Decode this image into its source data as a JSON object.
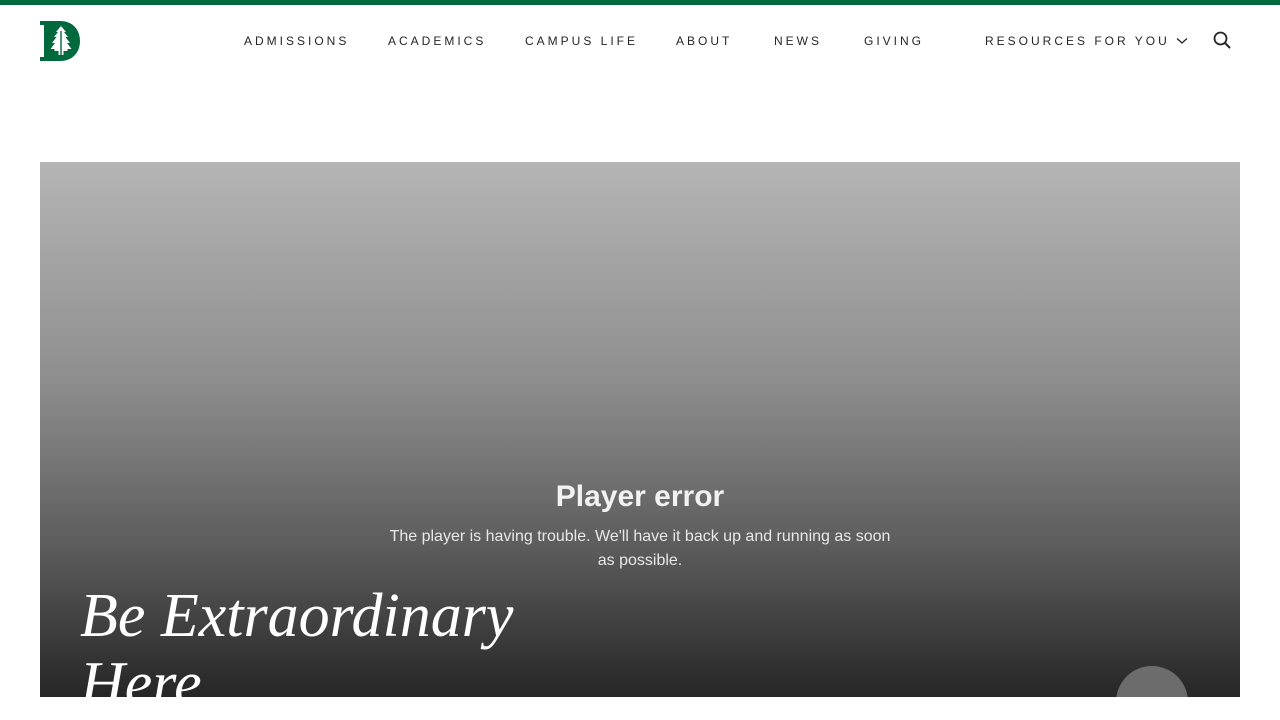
{
  "brand": {
    "logo_letter": "D",
    "accent_color": "#00693e"
  },
  "nav": {
    "items": [
      {
        "label": "ADMISSIONS"
      },
      {
        "label": "ACADEMICS"
      },
      {
        "label": "CAMPUS LIFE"
      },
      {
        "label": "ABOUT"
      },
      {
        "label": "NEWS"
      },
      {
        "label": "GIVING"
      }
    ],
    "resources_label": "RESOURCES FOR YOU",
    "resources_icon": "chevron-down-icon",
    "search_icon": "search-icon"
  },
  "hero": {
    "error_title": "Player error",
    "error_message": "The player is having trouble. We'll have it back up and running as soon as possible.",
    "headline": "Be Extraordinary Here"
  }
}
